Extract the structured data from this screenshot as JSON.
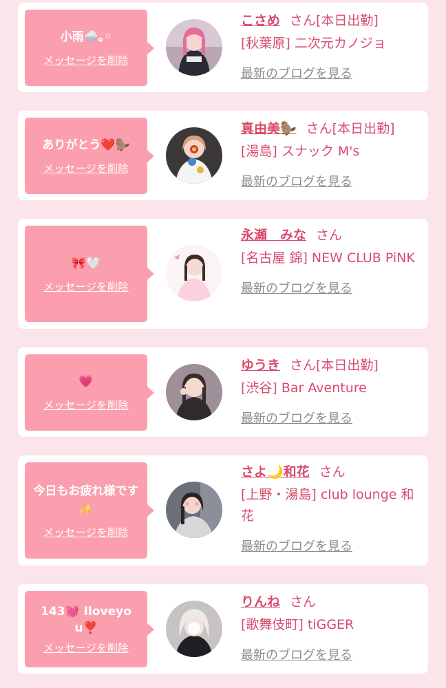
{
  "delete_label": "メッセージを削除",
  "blog_label": "最新のブログを見る",
  "colors": {
    "background": "#fbe4ea",
    "bubble": "#fb9fae",
    "accent_text": "#d94b6c",
    "link_gray": "#8c8c8c"
  },
  "items": [
    {
      "message": "小雨🌧️｡◦",
      "name": "こさめ",
      "suffix": "さん[本日出勤]",
      "shop": "[秋葉原] 二次元カノジョ"
    },
    {
      "message": "ありがとう❤️🦫",
      "name": "真由美🦫",
      "suffix": "さん[本日出勤]",
      "shop": "[湯島] スナック M's"
    },
    {
      "message": "🎀🤍",
      "name": "永瀬　みな",
      "suffix": "さん",
      "shop": "[名古屋 錦] NEW CLUB PiNK"
    },
    {
      "message": "💗",
      "name": "ゆうき",
      "suffix": "さん[本日出勤]",
      "shop": "[渋谷] Bar Aventure"
    },
    {
      "message": "今日もお疲れ様です✨",
      "name": "さよ🌙和花",
      "suffix": "さん",
      "shop": "[上野・湯島] club lounge 和花"
    },
    {
      "message": "143💓 Iloveyou❣️",
      "name": "りんね",
      "suffix": "さん",
      "shop": "[歌舞伎町] tiGGER"
    }
  ]
}
